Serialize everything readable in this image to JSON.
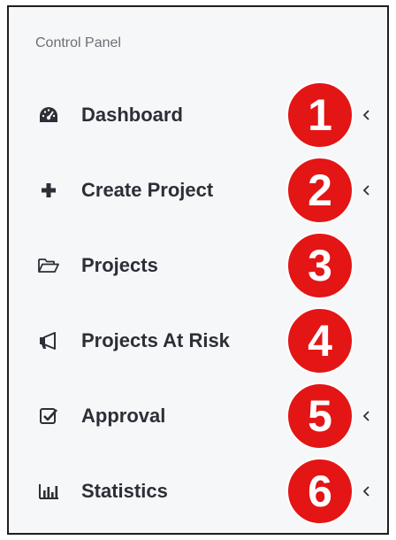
{
  "sidebar": {
    "title": "Control Panel",
    "items": [
      {
        "label": "Dashboard",
        "badge": "1",
        "icon": "dashboard-icon",
        "has_chevron": true
      },
      {
        "label": "Create Project",
        "badge": "2",
        "icon": "plus-icon",
        "has_chevron": true
      },
      {
        "label": "Projects",
        "badge": "3",
        "icon": "folder-open-icon",
        "has_chevron": false
      },
      {
        "label": "Projects At Risk",
        "badge": "4",
        "icon": "megaphone-icon",
        "has_chevron": false
      },
      {
        "label": "Approval",
        "badge": "5",
        "icon": "checkbox-icon",
        "has_chevron": true
      },
      {
        "label": "Statistics",
        "badge": "6",
        "icon": "bar-chart-icon",
        "has_chevron": true
      }
    ]
  },
  "colors": {
    "panel_bg": "#f6f7f9",
    "text": "#2b2f36",
    "muted": "#6b6f75",
    "badge_bg": "#e41515"
  }
}
